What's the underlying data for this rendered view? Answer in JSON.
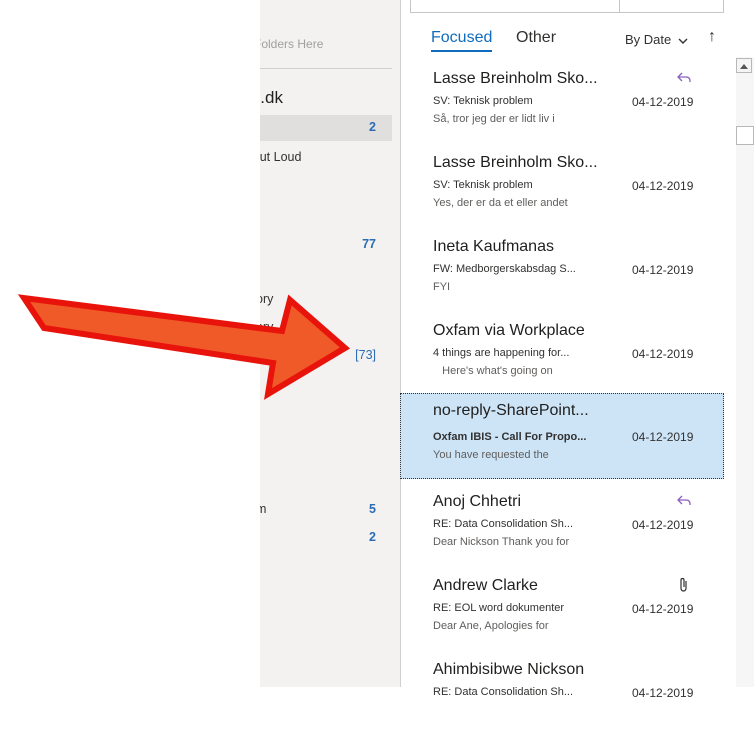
{
  "folders": {
    "hint": "e Folders Here",
    "account": "is.dk",
    "items": [
      {
        "label": "",
        "count": "2"
      },
      {
        "label": "Out Loud",
        "count": ""
      },
      {
        "label": "",
        "count": "77"
      },
      {
        "label": "ory",
        "count": ""
      },
      {
        "label": "ory",
        "count": "[73]"
      },
      {
        "label": "m",
        "count": "5"
      },
      {
        "label": "",
        "count": "2"
      }
    ]
  },
  "list": {
    "tabs": [
      {
        "label": "Focused"
      },
      {
        "label": "Other"
      }
    ],
    "sort_label": "By Date",
    "sort_arrow": "↑",
    "messages": [
      {
        "sender": "Lasse Breinholm Sko...",
        "subject": "SV: Teknisk problem",
        "date": "04-12-2019",
        "preview": "Så, tror jeg der er lidt liv i",
        "icon": "reply-icon"
      },
      {
        "sender": "Lasse Breinholm Sko...",
        "subject": "SV: Teknisk problem",
        "date": "04-12-2019",
        "preview": "Yes, der er da et eller andet",
        "icon": ""
      },
      {
        "sender": "Ineta Kaufmanas",
        "subject": "FW: Medborgerskabsdag S...",
        "date": "04-12-2019",
        "preview": "FYI",
        "icon": ""
      },
      {
        "sender": "Oxfam via Workplace",
        "subject": "4 things are happening for...",
        "date": "04-12-2019",
        "preview": "   Here's what's going on",
        "icon": ""
      },
      {
        "sender": "no-reply-SharePoint...",
        "subject": "Oxfam IBIS - Call For Propo...",
        "date": "04-12-2019",
        "preview": "You have requested the",
        "icon": ""
      },
      {
        "sender": "Anoj Chhetri",
        "subject": "RE: Data Consolidation Sh...",
        "date": "04-12-2019",
        "preview": "Dear Nickson  Thank you for",
        "icon": "reply-icon"
      },
      {
        "sender": "Andrew Clarke",
        "subject": "RE: EOL word dokumenter",
        "date": "04-12-2019",
        "preview": "Dear Ane,  Apologies for",
        "icon": "paperclip-icon"
      },
      {
        "sender": "Ahimbisibwe Nickson",
        "subject": "RE: Data Consolidation Sh...",
        "date": "04-12-2019",
        "preview": "",
        "icon": ""
      }
    ]
  },
  "colors": {
    "accent": "#0f6cbd",
    "selected": "#cde4f7",
    "arrow_fill": "#f05a28",
    "arrow_stroke": "#e8140c"
  }
}
